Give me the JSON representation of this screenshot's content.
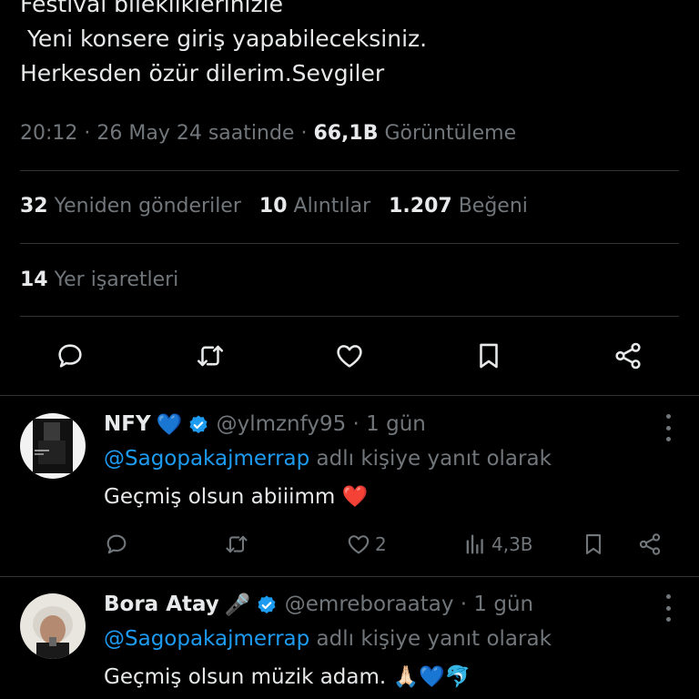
{
  "tweet": {
    "lines": [
      "Festival bilekliklerinizle",
      " Yeni konsere giriş yapabileceksiniz.",
      "Herkesden özür dilerim.Sevgiler"
    ],
    "time": "20:12",
    "sep1": " · ",
    "date": "26 May 24 saatinde",
    "sep2": " · ",
    "views": "66,1B",
    "views_label": "Görüntüleme"
  },
  "stats": {
    "reposts": "32",
    "reposts_label": "Yeniden gönderiler",
    "quotes": "10",
    "quotes_label": "Alıntılar",
    "likes": "1.207",
    "likes_label": "Beğeni",
    "bookmarks": "14",
    "bookmarks_label": "Yer işaretleri"
  },
  "icons": {
    "reply": "reply-icon",
    "repost": "repost-icon",
    "like": "heart-icon",
    "bookmark": "bookmark-icon",
    "share": "share-icon",
    "views": "analytics-icon",
    "verified": "verified-badge-icon",
    "more": "more-icon"
  },
  "colors": {
    "accent": "#1d9bf0",
    "text": "#e7e9ea",
    "muted": "#71767b",
    "divider": "#2f3336",
    "heart": "#e0245e"
  },
  "replies": [
    {
      "name": "NFY",
      "name_emoji": "💙",
      "handle": "@ylmznfy95",
      "sep": " · ",
      "time": "1 gün",
      "mention": "@Sagopakajmerrap",
      "reply_to_text": " adlı kişiye yanıt olarak",
      "text": "Geçmiş olsun abiiimm ❤️",
      "likes": "2",
      "views": "4,3B"
    },
    {
      "name": "Bora Atay",
      "name_emoji": "🎤",
      "handle": "@emreboraatay",
      "sep": " · ",
      "time": "1 gün",
      "mention": "@Sagopakajmerrap",
      "reply_to_text": " adlı kişiye yanıt olarak",
      "text": "Geçmiş olsun müzik adam. 🙏🏻💙🐬"
    }
  ]
}
